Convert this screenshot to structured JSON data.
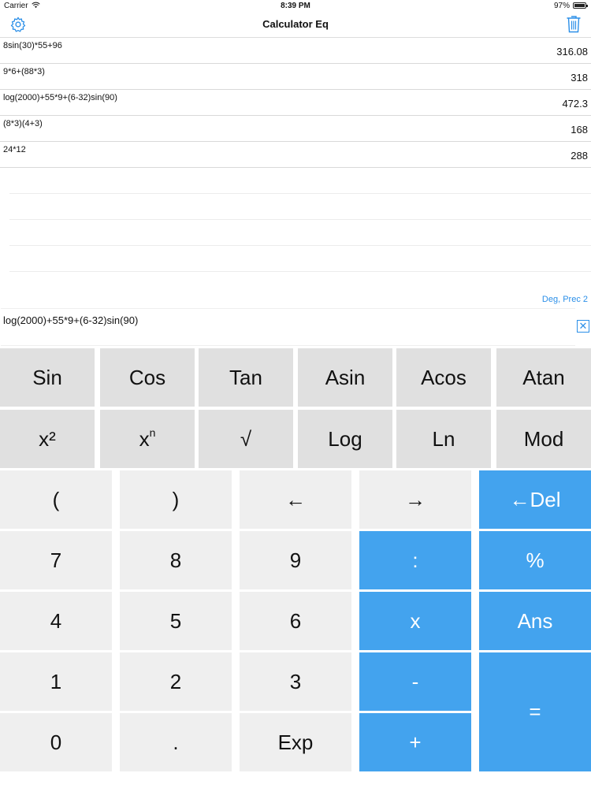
{
  "status": {
    "carrier": "Carrier",
    "time": "8:39 PM",
    "battery": "97%",
    "battery_level": 0.97
  },
  "nav": {
    "title": "Calculator Eq",
    "settings_icon": "gear-icon",
    "trash_icon": "trash-icon"
  },
  "history": [
    {
      "expr": "8sin(30)*55+96",
      "result": "316.08"
    },
    {
      "expr": "9*6+(88*3)",
      "result": "318"
    },
    {
      "expr": "log(2000)+55*9+(6-32)sin(90)",
      "result": "472.3"
    },
    {
      "expr": "(8*3)(4+3)",
      "result": "168"
    },
    {
      "expr": "24*12",
      "result": "288"
    }
  ],
  "mode": "Deg, Prec 2",
  "input": {
    "value": "log(2000)+55*9+(6-32)sin(90)",
    "clear_label": "✕"
  },
  "keys": {
    "sin": "Sin",
    "cos": "Cos",
    "tan": "Tan",
    "asin": "Asin",
    "acos": "Acos",
    "atan": "Atan",
    "x2": "x²",
    "xn_base": "x",
    "xn_exp": "n",
    "sqrt": "√",
    "log": "Log",
    "ln": "Ln",
    "mod": "Mod",
    "lparen": "(",
    "rparen": ")",
    "left": "←",
    "right": "→",
    "del": "←Del",
    "seven": "7",
    "eight": "8",
    "nine": "9",
    "divide": ":",
    "percent": "%",
    "four": "4",
    "five": "5",
    "six": "6",
    "multiply": "x",
    "ans": "Ans",
    "one": "1",
    "two": "2",
    "three": "3",
    "minus": "-",
    "equals": "=",
    "zero": "0",
    "dot": ".",
    "exp": "Exp",
    "plus": "+"
  },
  "colors": {
    "accent": "#43a3ee",
    "fn_key": "#e0e0e0",
    "num_key": "#efefef",
    "link": "#2b8fe8"
  }
}
